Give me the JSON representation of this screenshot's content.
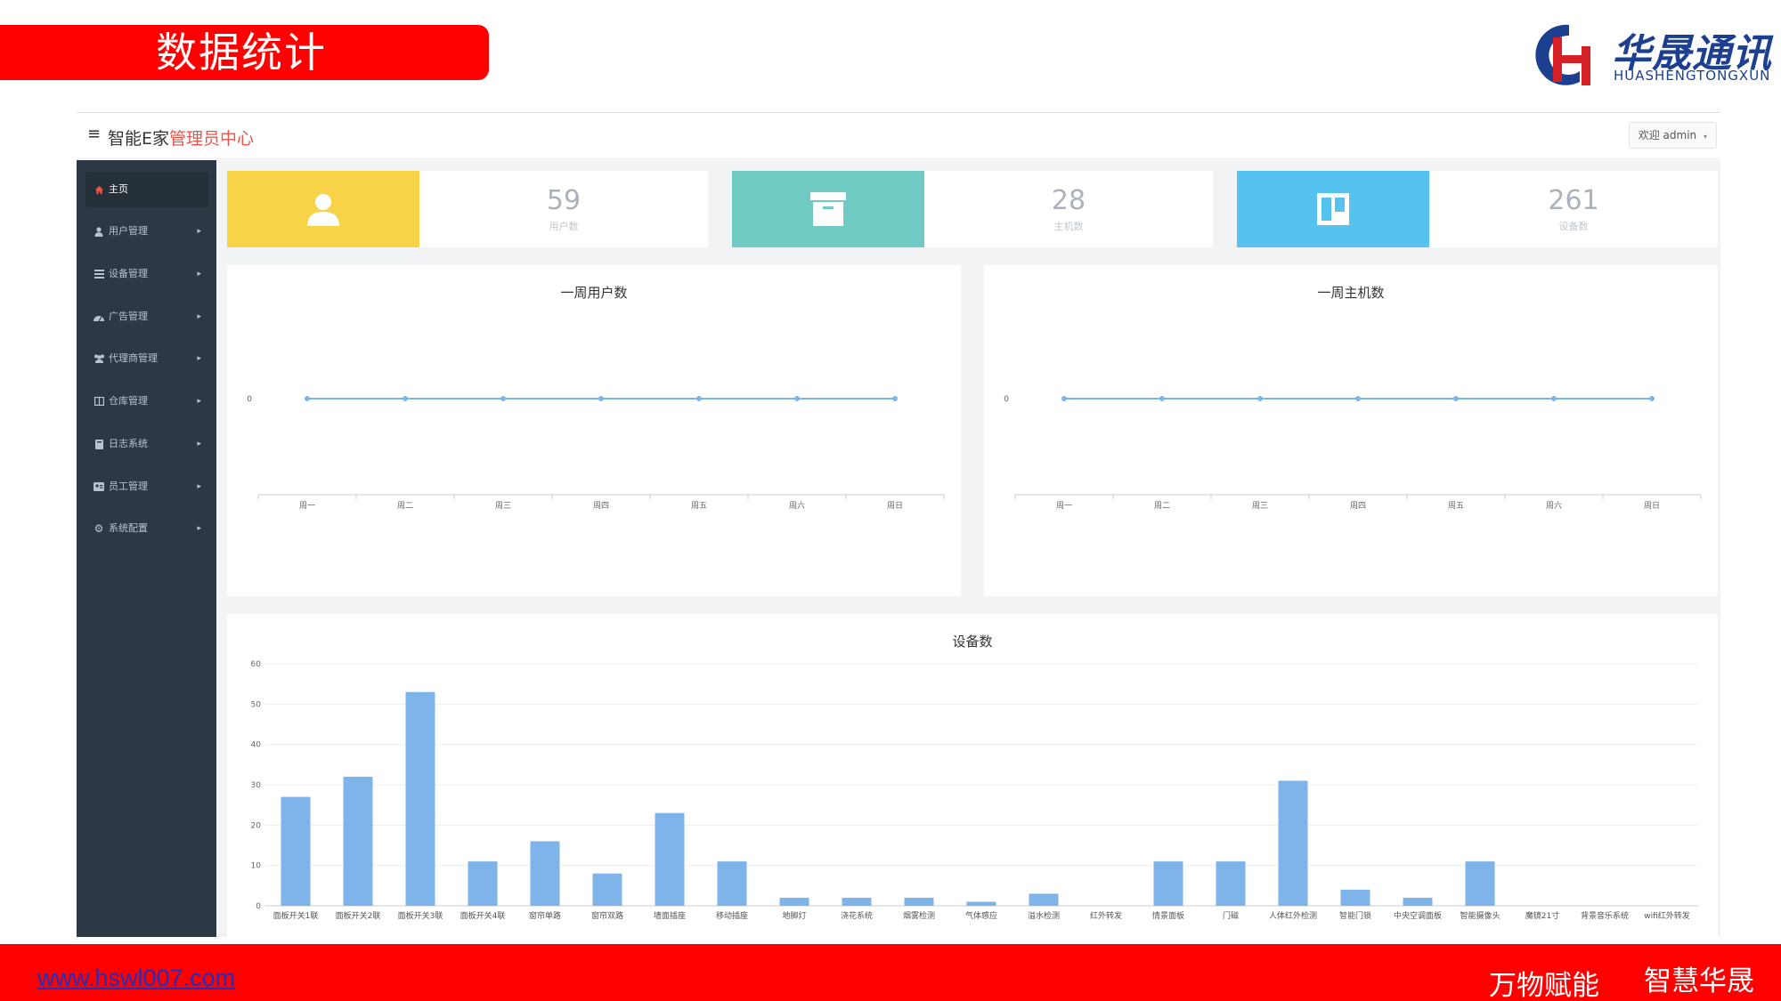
{
  "slide": {
    "title": "数据统计",
    "logo": {
      "cn": "华晟通讯",
      "en": "HUASHENGTONGXUN"
    },
    "footer": {
      "url": "www.hswl007.com",
      "slogan1": "万物赋能",
      "slogan2": "智慧华晟"
    }
  },
  "app": {
    "menu_icon": "≡",
    "brand_prefix": "智能E家",
    "brand_suffix": "管理员中心",
    "welcome": "欢迎 admin",
    "accent_color": "#e8554b"
  },
  "sidebar": {
    "items": [
      {
        "label": "主页",
        "icon": "home-icon",
        "active": true
      },
      {
        "label": "用户管理",
        "icon": "user-icon",
        "active": false
      },
      {
        "label": "设备管理",
        "icon": "list-icon",
        "active": false
      },
      {
        "label": "广告管理",
        "icon": "gauge-icon",
        "active": false
      },
      {
        "label": "代理商管理",
        "icon": "users-icon",
        "active": false
      },
      {
        "label": "仓库管理",
        "icon": "columns-icon",
        "active": false
      },
      {
        "label": "日志系统",
        "icon": "book-icon",
        "active": false
      },
      {
        "label": "员工管理",
        "icon": "id-card-icon",
        "active": false
      },
      {
        "label": "系统配置",
        "icon": "gear-icon",
        "active": false
      }
    ]
  },
  "stats": [
    {
      "value": "59",
      "caption": "用户数",
      "color": "#f8d348",
      "icon": "user-icon"
    },
    {
      "value": "28",
      "caption": "主机数",
      "color": "#6fcac4",
      "icon": "archive-icon"
    },
    {
      "value": "261",
      "caption": "设备数",
      "color": "#55c2f0",
      "icon": "board-icon"
    }
  ],
  "chart_data": [
    {
      "type": "line",
      "title": "一周用户数",
      "categories": [
        "周一",
        "周二",
        "周三",
        "周四",
        "周五",
        "周六",
        "周日"
      ],
      "values": [
        0,
        0,
        0,
        0,
        0,
        0,
        0
      ],
      "yticks": [
        0
      ],
      "color": "#7eb4ea"
    },
    {
      "type": "line",
      "title": "一周主机数",
      "categories": [
        "周一",
        "周二",
        "周三",
        "周四",
        "周五",
        "周六",
        "周日"
      ],
      "values": [
        0,
        0,
        0,
        0,
        0,
        0,
        0
      ],
      "yticks": [
        0
      ],
      "color": "#7eb4ea"
    },
    {
      "type": "bar",
      "title": "设备数",
      "categories": [
        "面板开关1联",
        "面板开关2联",
        "面板开关3联",
        "面板开关4联",
        "窗帘单路",
        "窗帘双路",
        "墙面插座",
        "移动插座",
        "地脚灯",
        "浇花系统",
        "烟雾检测",
        "气体感应",
        "溢水检测",
        "红外转发",
        "情景面板",
        "门磁",
        "人体红外检测",
        "智能门锁",
        "中央空调面板",
        "智能摄像头",
        "魔镜21寸",
        "背景音乐系统",
        "wifi红外转发"
      ],
      "values": [
        27,
        32,
        53,
        11,
        16,
        8,
        23,
        11,
        2,
        2,
        2,
        1,
        3,
        0,
        11,
        11,
        31,
        4,
        2,
        11,
        0,
        0,
        0
      ],
      "yticks": [
        0,
        10,
        20,
        30,
        40,
        50,
        60
      ],
      "ylim": [
        0,
        60
      ],
      "grid": true,
      "color": "#7eb4ea"
    }
  ]
}
